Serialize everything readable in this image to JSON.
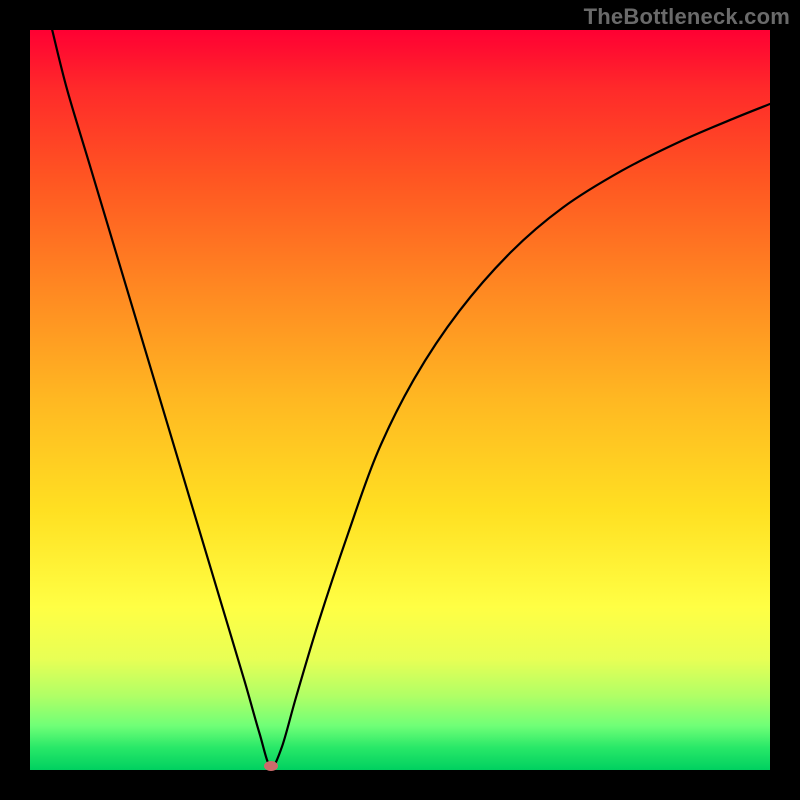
{
  "watermark": "TheBottleneck.com",
  "chart_data": {
    "type": "line",
    "title": "",
    "xlabel": "",
    "ylabel": "",
    "xlim": [
      0,
      100
    ],
    "ylim": [
      0,
      100
    ],
    "background_gradient_meaning": "value 0 = green (good), value 100 = red (bad)",
    "series": [
      {
        "name": "bottleneck-curve",
        "x": [
          3,
          5,
          8,
          11,
          14,
          17,
          20,
          23,
          26,
          29,
          31,
          32.5,
          34,
          36,
          39,
          43,
          47,
          52,
          58,
          65,
          72,
          80,
          88,
          95,
          100
        ],
        "y": [
          100,
          92,
          82,
          72,
          62,
          52,
          42,
          32,
          22,
          12,
          5,
          0.5,
          3,
          10,
          20,
          32,
          43,
          53,
          62,
          70,
          76,
          81,
          85,
          88,
          90
        ]
      }
    ],
    "marker": {
      "x": 32.5,
      "y": 0.5,
      "color": "#cc6b6b"
    }
  }
}
